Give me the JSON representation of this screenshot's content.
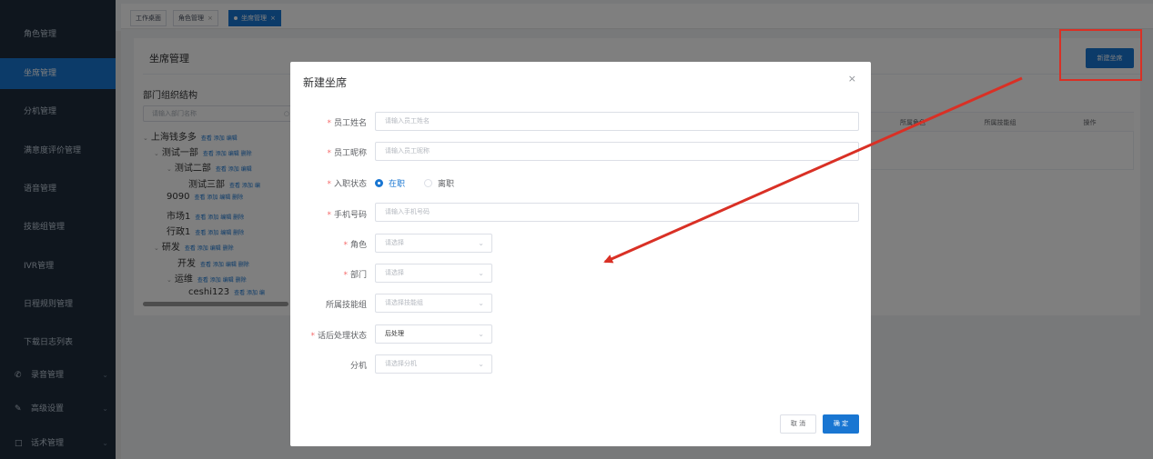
{
  "sidebar": {
    "items": [
      {
        "label": "角色管理"
      },
      {
        "label": "坐席管理"
      },
      {
        "label": "分机管理"
      },
      {
        "label": "满意度评价管理"
      },
      {
        "label": "语音管理"
      },
      {
        "label": "技能组管理"
      },
      {
        "label": "IVR管理"
      },
      {
        "label": "日程规则管理"
      },
      {
        "label": "下载日志列表"
      }
    ],
    "groups": [
      {
        "label": "录音管理",
        "icon": "phone-icon"
      },
      {
        "label": "高级设置",
        "icon": "pen-icon"
      },
      {
        "label": "话术管理",
        "icon": "chat-icon"
      }
    ]
  },
  "tabs": [
    {
      "label": "工作桌面"
    },
    {
      "label": "角色管理"
    },
    {
      "label": "坐席管理"
    }
  ],
  "page": {
    "title": "坐席管理",
    "new_button": "新建坐席",
    "org_title": "部门组织结构",
    "org_search_placeholder": "请输入部门名称",
    "tree": [
      {
        "label": "上海钱多多",
        "actions": "查看  添加  编辑"
      },
      {
        "label": "测试一部",
        "actions": "查看  添加  编辑  删除"
      },
      {
        "label": "测试二部",
        "actions": "查看  添加  编辑"
      },
      {
        "label": "测试三部",
        "actions": "查看  添加  编"
      },
      {
        "label": "9090",
        "actions": "查看  添加  编辑  删除"
      },
      {
        "label": "市场1",
        "actions": "查看  添加  编辑  删除"
      },
      {
        "label": "行政1",
        "actions": "查看  添加  编辑  删除"
      },
      {
        "label": "研发",
        "actions": "查看  添加  编辑  删除"
      },
      {
        "label": "开发",
        "actions": "查看  添加  编辑  删除"
      },
      {
        "label": "运维",
        "actions": "查看  添加  编辑  删除"
      },
      {
        "label": "ceshi123",
        "actions": "查看  添加  编"
      }
    ],
    "table_headers": [
      "所属角色",
      "所属技能组",
      "操作"
    ]
  },
  "dialog": {
    "title": "新建坐席",
    "fields": {
      "name_label": "员工姓名",
      "name_placeholder": "请输入员工姓名",
      "nickname_label": "员工昵称",
      "nickname_placeholder": "请输入员工昵称",
      "status_label": "入职状态",
      "status_option_on": "在职",
      "status_option_off": "离职",
      "phone_label": "手机号码",
      "phone_placeholder": "请输入手机号码",
      "role_label": "角色",
      "role_placeholder": "请选择",
      "dept_label": "部门",
      "dept_placeholder": "请选择",
      "skill_label": "所属技能组",
      "skill_placeholder": "请选择技能组",
      "after_call_label": "话后处理状态",
      "after_call_value": "后处理",
      "ext_label": "分机",
      "ext_placeholder": "请选择分机"
    },
    "cancel_label": "取 消",
    "ok_label": "确 定"
  },
  "colors": {
    "primary": "#1976d2",
    "sidebar_bg": "#1f2d3d",
    "required": "#f56c6c",
    "annotation": "#d93025"
  }
}
